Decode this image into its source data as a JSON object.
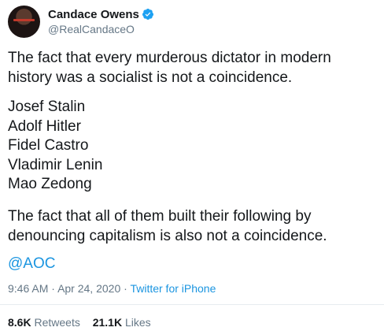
{
  "author": {
    "display_name": "Candace Owens",
    "handle": "@RealCandaceO"
  },
  "tweet": {
    "paragraph_1": "The fact that every murderous dictator in modern history was a socialist is not a coincidence.",
    "list": [
      "Josef Stalin",
      "Adolf Hitler",
      "Fidel Castro",
      "Vladimir Lenin",
      "Mao Zedong"
    ],
    "paragraph_2": "The fact that all of them built their following by denouncing capitalism is also not a coincidence.",
    "mention": "@AOC"
  },
  "meta": {
    "time": "9:46 AM",
    "separator": "·",
    "date": "Apr 24, 2020",
    "source": "Twitter for iPhone"
  },
  "stats": {
    "retweets_count": "8.6K",
    "retweets_label": "Retweets",
    "likes_count": "21.1K",
    "likes_label": "Likes"
  },
  "colors": {
    "link": "#1b95e0",
    "secondary_text": "#657786",
    "verified_badge": "#1da1f2"
  },
  "icons": {
    "verified": "verified-badge-icon"
  }
}
